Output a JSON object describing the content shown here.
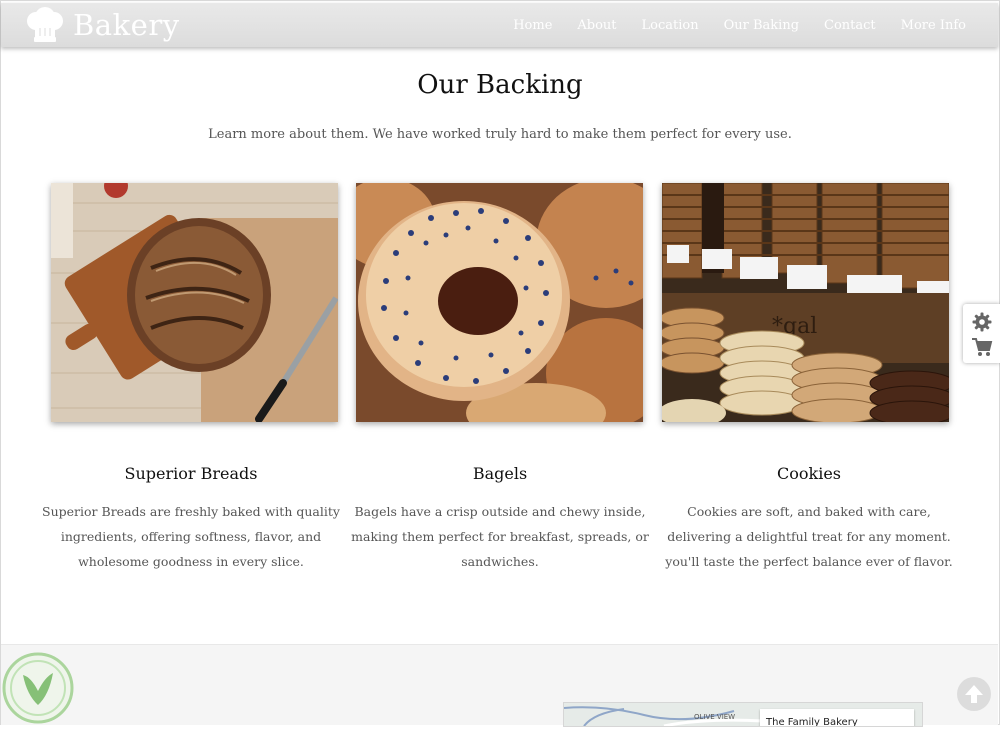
{
  "brand": {
    "name": "Bakery",
    "logo_icon": "chef-hat-icon"
  },
  "nav": {
    "items": [
      "Home",
      "About",
      "Location",
      "Our Baking",
      "Contact",
      "More Info"
    ]
  },
  "section": {
    "title": "Our Backing",
    "subtitle": "Learn more about them. We have worked truly hard to make them perfect for every use."
  },
  "cards": [
    {
      "title": "Superior Breads",
      "desc": "Superior Breads are freshly baked with quality ingredients, offering softness, flavor, and wholesome goodness in every slice."
    },
    {
      "title": "Bagels",
      "desc": "Bagels have a crisp outside and chewy inside, making them perfect for breakfast, spreads, or sandwiches."
    },
    {
      "title": "Cookies",
      "desc": "Cookies are soft, and baked with care, delivering a delightful treat for any moment. you'll taste the perfect balance ever of flavor."
    }
  ],
  "side_panel": {
    "icons": [
      "gear-icon",
      "cart-icon"
    ]
  },
  "map": {
    "area_label": "OLIVE VIEW",
    "place_title": "The Family Bakery"
  },
  "colors": {
    "navbar": "#dfdfdf",
    "nav_text": "#ffffff",
    "footer": "#f5f5f5",
    "badge_green": "#5aa74a"
  }
}
